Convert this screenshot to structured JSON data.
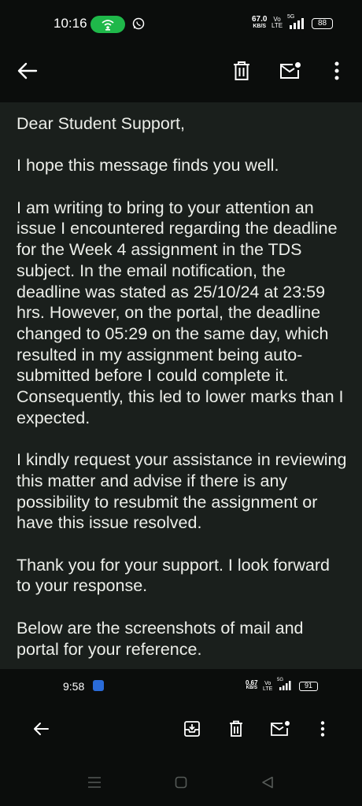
{
  "status_bar": {
    "time": "10:16",
    "speed_value": "67.0",
    "speed_unit": "KB/S",
    "volte_top": "Vo",
    "volte_bottom": "LTE",
    "network": "5G",
    "battery": "88",
    "icons": [
      "hotspot-icon",
      "whatsapp-icon",
      "signal-icon",
      "battery-icon"
    ]
  },
  "toolbar": {
    "icons": [
      "back-arrow-icon",
      "trash-icon",
      "mark-unread-icon",
      "more-vert-icon"
    ]
  },
  "email": {
    "paragraphs": [
      "Dear Student Support,",
      "I hope this message finds you well.",
      "I am writing to bring to your attention an issue I encountered regarding the deadline for the Week 4 assignment in the TDS subject. In the email notification, the deadline was stated as 25/10/24 at 23:59 hrs. However, on the portal, the deadline changed to 05:29 on the same day, which resulted in my assignment being auto-submitted before I could complete it. Consequently, this led to lower marks than I expected.",
      "I kindly request your assistance in reviewing this matter and advise if there is any possibility to resubmit the assignment or have this issue resolved.",
      "Thank you for your support. I look forward to your response.",
      "Below are the screenshots of mail and portal for your reference."
    ]
  },
  "embedded_screenshot": {
    "time": "9:58",
    "speed_value": "0.67",
    "speed_unit": "KB/S",
    "volte_top": "Vo",
    "volte_bottom": "LTE",
    "network": "5G",
    "battery": "91",
    "toolbar_icons": [
      "back-arrow-icon",
      "archive-icon",
      "trash-icon",
      "mark-unread-icon",
      "more-vert-icon"
    ]
  },
  "nav_bar": {
    "icons": [
      "recents-icon",
      "home-icon",
      "back-icon"
    ]
  },
  "colors": {
    "background": "#0b0d0c",
    "body_background": "#1a1f1c",
    "text": "#eceee9",
    "hotspot_green": "#1fb84a"
  }
}
